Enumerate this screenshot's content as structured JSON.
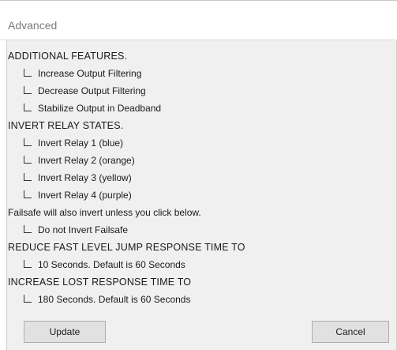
{
  "window": {
    "title": "Advanced"
  },
  "sections": {
    "additional_features": {
      "heading": "ADDITIONAL FEATURES.",
      "items": [
        "Increase Output Filtering",
        "Decrease Output Filtering",
        "Stabilize Output in Deadband"
      ]
    },
    "invert_relay": {
      "heading": "INVERT RELAY STATES.",
      "items": [
        "Invert Relay 1 (blue)",
        "Invert Relay 2 (orange)",
        "Invert Relay 3 (yellow)",
        "Invert Relay 4 (purple)"
      ]
    },
    "failsafe": {
      "note": "Failsafe will also invert unless you click below.",
      "item": "Do not Invert Failsafe"
    },
    "fast_level_jump": {
      "heading": "REDUCE FAST LEVEL JUMP RESPONSE TIME TO",
      "item": "10 Seconds. Default is 60 Seconds"
    },
    "lost_response": {
      "heading": "INCREASE LOST RESPONSE TIME TO",
      "item": "180 Seconds. Default is 60 Seconds"
    }
  },
  "checkbox_states": {
    "increase_output_filtering": false,
    "decrease_output_filtering": false,
    "stabilize_output_in_deadband": false,
    "invert_relay_1": false,
    "invert_relay_2": false,
    "invert_relay_3": false,
    "invert_relay_4": false,
    "do_not_invert_failsafe": false,
    "fast_level_jump_10s": false,
    "lost_response_180s": false
  },
  "buttons": {
    "update": "Update",
    "cancel": "Cancel"
  },
  "colors": {
    "body_background": "#f0f0f0",
    "title_text": "#7a7a7a",
    "button_background": "#e1e1e1",
    "button_border": "#adadad"
  }
}
